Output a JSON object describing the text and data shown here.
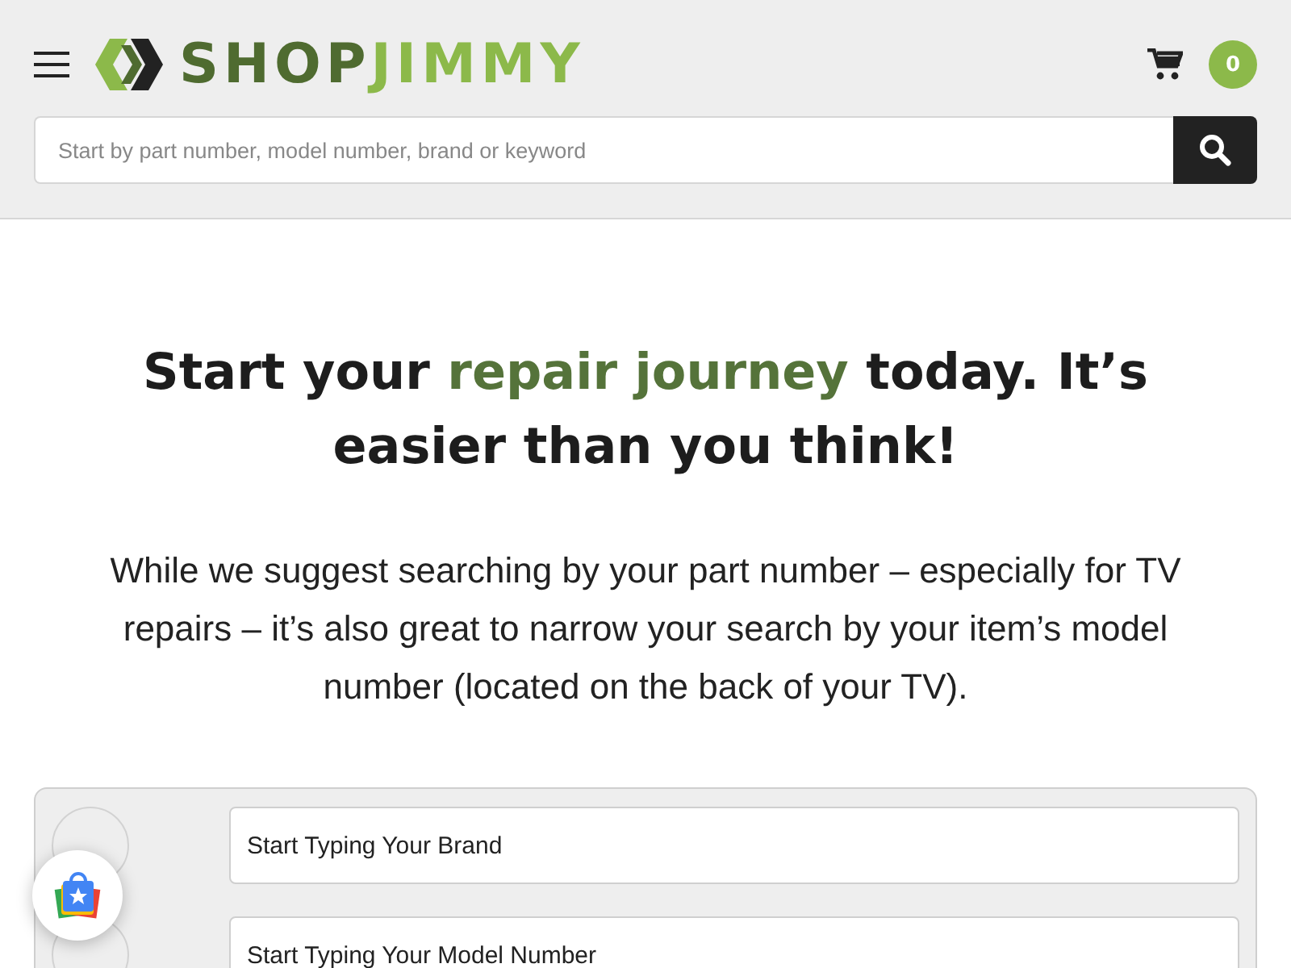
{
  "header": {
    "logo": {
      "part_1": "SHOP",
      "part_2": "JIMMY"
    },
    "cart_count": "0",
    "search": {
      "placeholder": "Start by part number, model number, brand or keyword"
    }
  },
  "hero": {
    "heading": [
      {
        "text": "Start your ",
        "highlight": false
      },
      {
        "text": "repair journey",
        "highlight": true
      },
      {
        "text": " today. It’s easier than you think!",
        "highlight": false
      }
    ],
    "intro": "While we suggest searching by your part number – especially for TV repairs – it’s also great to narrow your search by your item’s model number (located on the back of your TV)."
  },
  "steps": [
    {
      "placeholder": "Start Typing Your Brand"
    },
    {
      "placeholder": "Start Typing Your Model Number"
    }
  ]
}
